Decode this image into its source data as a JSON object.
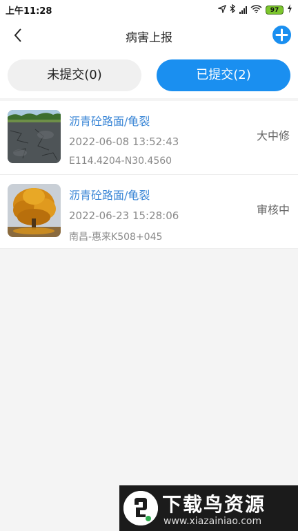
{
  "status_bar": {
    "time": "上午11:28",
    "battery": "97"
  },
  "header": {
    "title": "病害上报"
  },
  "tabs": [
    {
      "label": "未提交(0)",
      "selected": false
    },
    {
      "label": "已提交(2)",
      "selected": true
    }
  ],
  "records": [
    {
      "title": "沥青砼路面/龟裂",
      "datetime": "2022-06-08 13:52:43",
      "location": "E114.4204-N30.4560",
      "status": "大中修",
      "thumbnail": "road-photo"
    },
    {
      "title": "沥青砼路面/龟裂",
      "datetime": "2022-06-23 15:28:06",
      "location": "南昌-惠来K508+045",
      "status": "审核中",
      "thumbnail": "autumn-tree-photo"
    }
  ],
  "watermark": {
    "title": "下载鸟资源",
    "url": "www.xiazainiao.com"
  },
  "colors": {
    "accent": "#1a8ff0",
    "title_text": "#3a86d6"
  }
}
